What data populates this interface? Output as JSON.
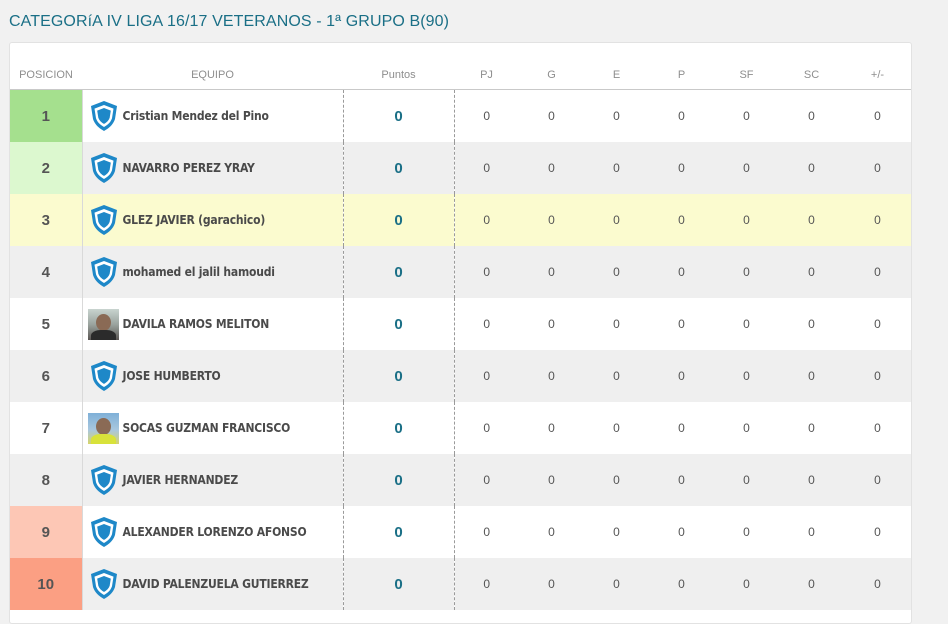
{
  "title": "CATEGORíA IV LIGA 16/17 VETERANOS - 1ª GRUPO B(90)",
  "colors": {
    "pos_1": "#a5e08e",
    "pos_2": "#dcf8cf",
    "pos_3": "#fbfbcf",
    "pos_9": "#fdc7b5",
    "pos_10": "#fb9f83",
    "points": "#1a6f86",
    "crest": "#1e88c8"
  },
  "columns": {
    "posicion": "POSICION",
    "equipo": "EQUIPO",
    "puntos": "Puntos",
    "pj": "PJ",
    "g": "G",
    "e": "E",
    "p": "P",
    "sf": "SF",
    "sc": "SC",
    "diff": "+/-"
  },
  "rows": [
    {
      "pos": "1",
      "team": "Cristian Mendez del Pino",
      "icon": "shield-crest-icon",
      "pts": "0",
      "pj": "0",
      "g": "0",
      "e": "0",
      "p": "0",
      "sf": "0",
      "sc": "0",
      "diff": "0"
    },
    {
      "pos": "2",
      "team": "NAVARRO PEREZ YRAY",
      "icon": "shield-crest-icon",
      "pts": "0",
      "pj": "0",
      "g": "0",
      "e": "0",
      "p": "0",
      "sf": "0",
      "sc": "0",
      "diff": "0"
    },
    {
      "pos": "3",
      "team": "GLEZ JAVIER (garachico)",
      "icon": "shield-crest-icon",
      "pts": "0",
      "pj": "0",
      "g": "0",
      "e": "0",
      "p": "0",
      "sf": "0",
      "sc": "0",
      "diff": "0"
    },
    {
      "pos": "4",
      "team": "mohamed el jalil hamoudi",
      "icon": "shield-crest-icon",
      "pts": "0",
      "pj": "0",
      "g": "0",
      "e": "0",
      "p": "0",
      "sf": "0",
      "sc": "0",
      "diff": "0"
    },
    {
      "pos": "5",
      "team": "DAVILA RAMOS MELITON",
      "icon": "player-photo",
      "pts": "0",
      "pj": "0",
      "g": "0",
      "e": "0",
      "p": "0",
      "sf": "0",
      "sc": "0",
      "diff": "0"
    },
    {
      "pos": "6",
      "team": "JOSE HUMBERTO",
      "icon": "shield-crest-icon",
      "pts": "0",
      "pj": "0",
      "g": "0",
      "e": "0",
      "p": "0",
      "sf": "0",
      "sc": "0",
      "diff": "0"
    },
    {
      "pos": "7",
      "team": "SOCAS GUZMAN FRANCISCO",
      "icon": "player-photo",
      "pts": "0",
      "pj": "0",
      "g": "0",
      "e": "0",
      "p": "0",
      "sf": "0",
      "sc": "0",
      "diff": "0"
    },
    {
      "pos": "8",
      "team": "JAVIER HERNANDEZ",
      "icon": "shield-crest-icon",
      "pts": "0",
      "pj": "0",
      "g": "0",
      "e": "0",
      "p": "0",
      "sf": "0",
      "sc": "0",
      "diff": "0"
    },
    {
      "pos": "9",
      "team": "ALEXANDER LORENZO AFONSO",
      "icon": "shield-crest-icon",
      "pts": "0",
      "pj": "0",
      "g": "0",
      "e": "0",
      "p": "0",
      "sf": "0",
      "sc": "0",
      "diff": "0"
    },
    {
      "pos": "10",
      "team": "DAVID PALENZUELA GUTIERREZ",
      "icon": "shield-crest-icon",
      "pts": "0",
      "pj": "0",
      "g": "0",
      "e": "0",
      "p": "0",
      "sf": "0",
      "sc": "0",
      "diff": "0"
    }
  ]
}
